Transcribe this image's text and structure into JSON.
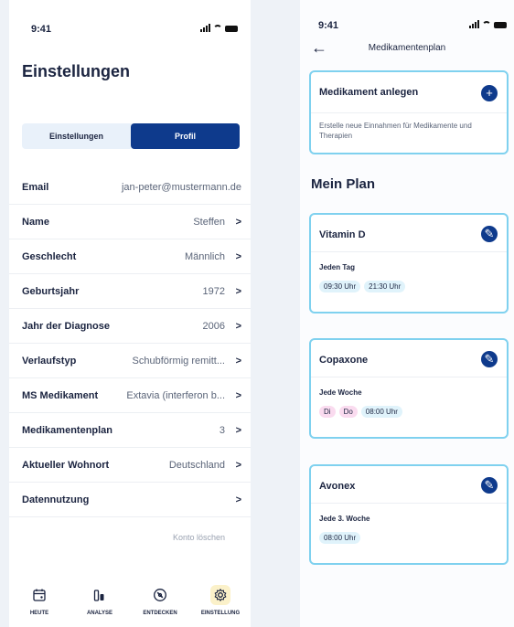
{
  "left": {
    "status_time": "9:41",
    "title": "Einstellungen",
    "tabs": [
      "Einstellungen",
      "Profil"
    ],
    "rows": [
      {
        "label": "Email",
        "value": "jan-peter@mustermann.de",
        "chevron": ""
      },
      {
        "label": "Name",
        "value": "Steffen",
        "chevron": ">"
      },
      {
        "label": "Geschlecht",
        "value": "Männlich",
        "chevron": ">"
      },
      {
        "label": "Geburtsjahr",
        "value": "1972",
        "chevron": ">"
      },
      {
        "label": "Jahr der Diagnose",
        "value": "2006",
        "chevron": ">"
      },
      {
        "label": "Verlaufstyp",
        "value": "Schubförmig remitt...",
        "chevron": ">"
      },
      {
        "label": "MS Medikament",
        "value": "Extavia (interferon b...",
        "chevron": ">"
      },
      {
        "label": "Medikamentenplan",
        "value": "3",
        "chevron": ">"
      },
      {
        "label": "Aktueller Wohnort",
        "value": "Deutschland",
        "chevron": ">"
      },
      {
        "label": "Datennutzung",
        "value": "",
        "chevron": ">"
      }
    ],
    "delete_label": "Konto löschen",
    "nav": [
      {
        "label": "HEUTE",
        "icon": "calendar-icon"
      },
      {
        "label": "ANALYSE",
        "icon": "analysis-icon"
      },
      {
        "label": "ENTDECKEN",
        "icon": "compass-icon"
      },
      {
        "label": "EINSTELLUNG",
        "icon": "gear-icon"
      }
    ]
  },
  "right": {
    "status_time": "9:41",
    "header_title": "Medikamentenplan",
    "add_card": {
      "title": "Medikament anlegen",
      "description": "Erstelle neue Einnahmen für Medikamente und Therapien"
    },
    "section_title": "Mein Plan",
    "medications": [
      {
        "name": "Vitamin D",
        "frequency": "Jeden Tag",
        "days": [],
        "times": [
          "09:30 Uhr",
          "21:30 Uhr"
        ]
      },
      {
        "name": "Copaxone",
        "frequency": "Jede Woche",
        "days": [
          "Di",
          "Do"
        ],
        "times": [
          "08:00 Uhr"
        ]
      },
      {
        "name": "Avonex",
        "frequency": "Jede 3. Woche",
        "days": [],
        "times": [
          "08:00 Uhr"
        ]
      }
    ]
  },
  "colors": {
    "primary": "#0e3a8c",
    "card_border": "#7fd1ef",
    "time_chip": "#e0f3fb",
    "day_chip": "#fadbef",
    "active_nav": "#fbf1c9"
  }
}
